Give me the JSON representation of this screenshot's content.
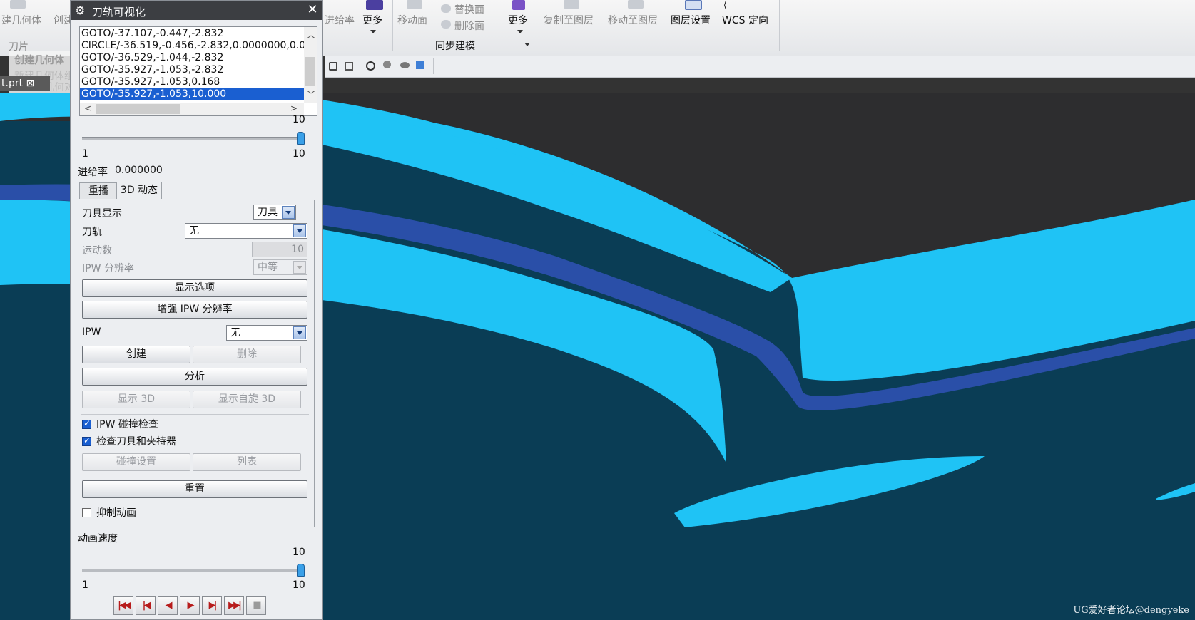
{
  "ribbon": {
    "group_blade": "刀片",
    "create_geometry": "建几何体",
    "create_short": "创建",
    "feed_rate": "进给率",
    "more_1": "更多",
    "move_face": "移动面",
    "replace_face": "替换面",
    "delete_face": "删除面",
    "more_2": "更多",
    "sync_modeling": "同步建模",
    "copy_to_layer": "复制至图层",
    "move_to_layer": "移动至图层",
    "layer_settings": "图层设置",
    "wcs_orient": "WCS 定向"
  },
  "nav_tooltip": {
    "title": "创建几何体",
    "line1": "新建几何体组",
    "line2": "放置的几何对象",
    "part_tab": "t.prt ⊠"
  },
  "dialog": {
    "title": "刀轨可视化",
    "cl_lines": [
      "GOTO/-37.107,-0.447,-2.832",
      "CIRCLE/-36.519,-0.456,-2.832,0.0000000,0.0",
      "GOTO/-36.529,-1.044,-2.832",
      "GOTO/-35.927,-1.053,-2.832",
      "GOTO/-35.927,-1.053,0.168",
      "GOTO/-35.927,-1.053,10.000"
    ],
    "slider1": {
      "current": "10",
      "min": "1",
      "max": "10",
      "fraction": 1.0
    },
    "feed_rate_label": "进给率",
    "feed_rate_value": "0.000000",
    "tabs": [
      "重播",
      "3D 动态"
    ],
    "active_tab": "3D 动态",
    "tool_display_label": "刀具显示",
    "tool_display_value": "刀具",
    "path_label": "刀轨",
    "path_value": "无",
    "motion_count_label": "运动数",
    "motion_count_value": "10",
    "ipw_res_label": "IPW 分辨率",
    "ipw_res_value": "中等",
    "display_options": "显示选项",
    "enhance_ipw": "增强 IPW 分辨率",
    "ipw_label": "IPW",
    "ipw_value": "无",
    "create": "创建",
    "delete": "删除",
    "analyze": "分析",
    "show_3d": "显示 3D",
    "show_spin_3d": "显示自旋 3D",
    "ipw_collision": "IPW 碰撞检查",
    "check_tool_holder": "检查刀具和夹持器",
    "collision_settings": "碰撞设置",
    "list": "列表",
    "reset": "重置",
    "suppress_anim": "抑制动画",
    "anim_speed_label": "动画速度",
    "slider2": {
      "current": "10",
      "min": "1",
      "max": "10",
      "fraction": 1.0
    }
  },
  "watermark": "UG爱好者论坛@dengyeke",
  "colors": {
    "part_face": "#1fc3f5",
    "part_edge": "#2a4fa8",
    "floor": "#0a3d55",
    "background": "#2d2d2f"
  }
}
